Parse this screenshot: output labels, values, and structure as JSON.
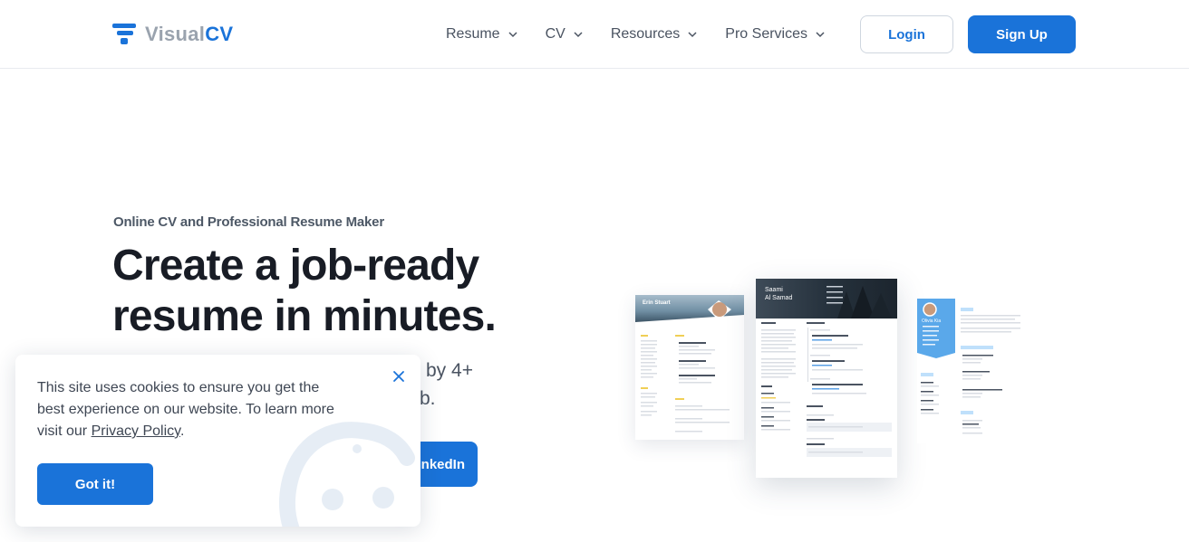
{
  "brand": {
    "name_part1": "Visual",
    "name_part2": "CV",
    "accent": "#1a73d9"
  },
  "nav": {
    "items": [
      {
        "label": "Resume",
        "icon": "chevron-down-icon"
      },
      {
        "label": "CV",
        "icon": "chevron-down-icon"
      },
      {
        "label": "Resources",
        "icon": "chevron-down-icon"
      },
      {
        "label": "Pro Services",
        "icon": "chevron-down-icon"
      }
    ],
    "login_label": "Login",
    "signup_label": "Sign Up"
  },
  "hero": {
    "eyebrow": "Online CV and Professional Resume Maker",
    "headline": "Create a job-ready resume in minutes.",
    "sub_line1": "by 4+",
    "sub_line2": "b.",
    "linkedin_label": "nkedIn"
  },
  "resumes": {
    "left_name": "Erin Stuart",
    "mid_name_line1": "Saami",
    "mid_name_line2": "Al Samad",
    "right_name": "Olivia Kia"
  },
  "cookie": {
    "text_before_link": "This site uses cookies to ensure you get the best experience on our website. To learn more visit our ",
    "link_text": "Privacy Policy",
    "text_after_link": ".",
    "button_label": "Got it!",
    "close_icon": "close-icon"
  }
}
